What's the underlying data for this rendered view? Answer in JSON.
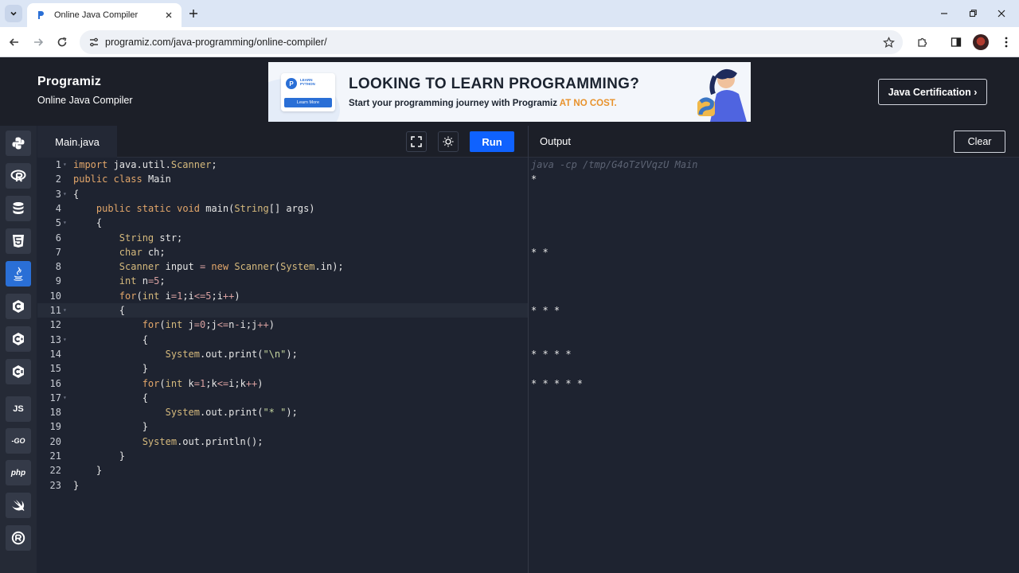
{
  "browser": {
    "tab_title": "Online Java Compiler",
    "url": "programiz.com/java-programming/online-compiler/"
  },
  "site": {
    "logo_text": "Programiz",
    "subtitle": "Online Java Compiler",
    "certification_label": "Java Certification ›",
    "ad": {
      "card_line1": "LEARN",
      "card_line2": "PYTHON",
      "card_button": "Learn More",
      "headline": "LOOKING TO LEARN PROGRAMMING?",
      "text": "Start your programming journey with Programiz ",
      "highlight": "AT NO COST."
    }
  },
  "rail": {
    "items": [
      {
        "name": "python",
        "icon": "python-icon"
      },
      {
        "name": "r",
        "icon": "r-icon"
      },
      {
        "name": "sql",
        "icon": "database-icon"
      },
      {
        "name": "html",
        "icon": "html5-icon"
      },
      {
        "name": "java",
        "icon": "java-icon",
        "active": true
      },
      {
        "name": "c",
        "icon": "c-icon"
      },
      {
        "name": "cpp",
        "icon": "cpp-icon"
      },
      {
        "name": "csharp",
        "icon": "csharp-icon"
      },
      {
        "name": "js",
        "label": "JS"
      },
      {
        "name": "go",
        "label": "-GO"
      },
      {
        "name": "php",
        "label": "php"
      },
      {
        "name": "swift",
        "icon": "swift-icon"
      },
      {
        "name": "rust",
        "icon": "rust-icon"
      }
    ]
  },
  "editor": {
    "file_name": "Main.java",
    "run_label": "Run",
    "active_line": 11,
    "lines": [
      {
        "n": "1",
        "fold": true
      },
      {
        "n": "2",
        "fold": false
      },
      {
        "n": "3",
        "fold": true
      },
      {
        "n": "4",
        "fold": false
      },
      {
        "n": "5",
        "fold": true
      },
      {
        "n": "6",
        "fold": false
      },
      {
        "n": "7",
        "fold": false
      },
      {
        "n": "8",
        "fold": false
      },
      {
        "n": "9",
        "fold": false
      },
      {
        "n": "10",
        "fold": false
      },
      {
        "n": "11",
        "fold": true
      },
      {
        "n": "12",
        "fold": false
      },
      {
        "n": "13",
        "fold": true
      },
      {
        "n": "14",
        "fold": false
      },
      {
        "n": "15",
        "fold": false
      },
      {
        "n": "16",
        "fold": false
      },
      {
        "n": "17",
        "fold": true
      },
      {
        "n": "18",
        "fold": false
      },
      {
        "n": "19",
        "fold": false
      },
      {
        "n": "20",
        "fold": false
      },
      {
        "n": "21",
        "fold": false
      },
      {
        "n": "22",
        "fold": false
      },
      {
        "n": "23",
        "fold": false
      }
    ],
    "code": [
      "import java.util.Scanner;",
      "public class Main",
      "{",
      "    public static void main(String[] args)",
      "    {",
      "        String str;",
      "        char ch;",
      "        Scanner input = new Scanner(System.in);",
      "        int n=5;",
      "        for(int i=1;i<=5;i++)",
      "        {",
      "            for(int j=0;j<=n-i;j++)",
      "            {",
      "                System.out.print(\"\\n\");",
      "            }",
      "            for(int k=1;k<=i;k++)",
      "            {",
      "                System.out.print(\"* \");",
      "            }",
      "            System.out.println();",
      "        }",
      "    }",
      "}"
    ]
  },
  "output": {
    "title": "Output",
    "clear_label": "Clear",
    "command": "java -cp /tmp/G4oTzVVqzU Main",
    "lines": [
      {
        "row": 1,
        "text": "*"
      },
      {
        "row": 6,
        "text": "* *"
      },
      {
        "row": 10,
        "text": "* * *"
      },
      {
        "row": 13,
        "text": "* * * *"
      },
      {
        "row": 15,
        "text": "* * * * *"
      }
    ]
  }
}
